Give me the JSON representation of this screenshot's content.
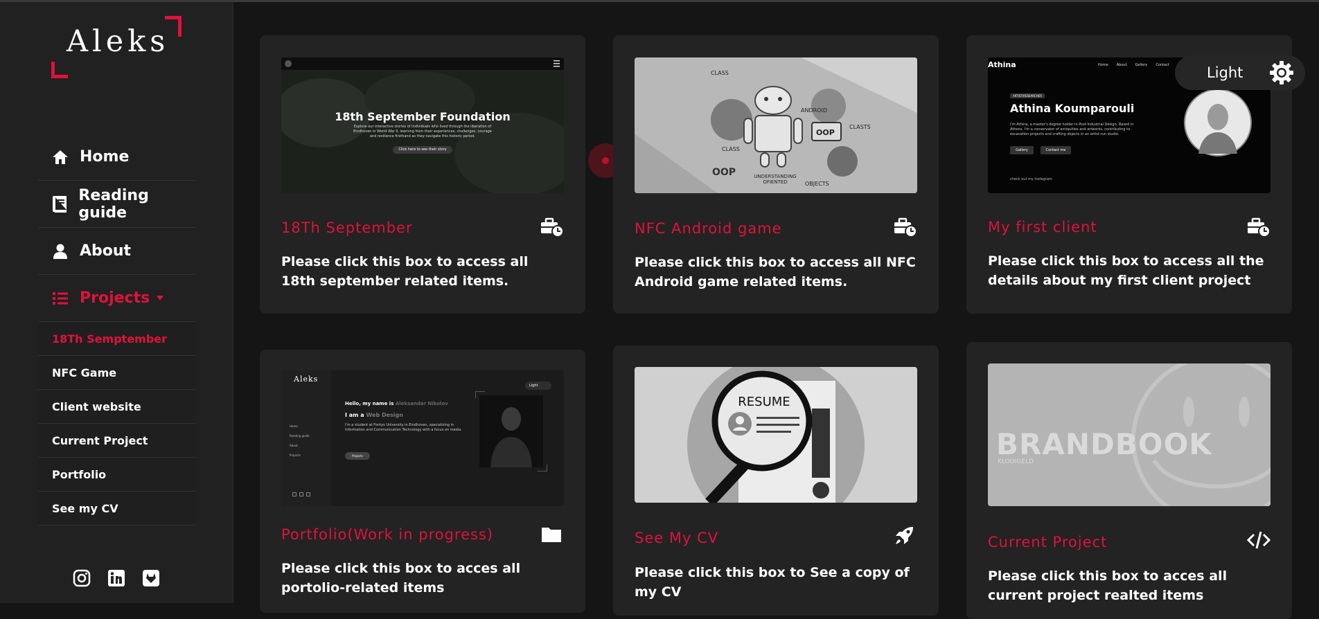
{
  "logo": {
    "text": "Aleks"
  },
  "nav": {
    "items": [
      {
        "label": "Home"
      },
      {
        "label": "Reading guide"
      },
      {
        "label": "About"
      },
      {
        "label": "Projects"
      }
    ],
    "projects_sub": [
      {
        "label": "18Th Semptember"
      },
      {
        "label": "NFC Game"
      },
      {
        "label": "Client website"
      },
      {
        "label": "Current Project"
      },
      {
        "label": "Portfolio"
      },
      {
        "label": "See my CV"
      }
    ]
  },
  "theme_toggle": {
    "label": "Light"
  },
  "cards": [
    {
      "title": "18Th September",
      "desc": "Please click this box to access all 18th september related items.",
      "icon": "briefcase-clock-icon",
      "thumb": {
        "heading": "18th September Foundation",
        "body": "Explore our interactive stories of individuals who lived through the liberation of Eindhoven in World War II, learning from their experiences, challenges, courage and resilience firsthand as they navigate this historic period.",
        "button": "Click here to see their story"
      }
    },
    {
      "title": "NFC Android game",
      "desc": "Please click this box to access all NFC Android game related items.",
      "icon": "briefcase-clock-icon",
      "thumb": {
        "labels": [
          "CLASS",
          "ANDROID",
          "OOP",
          "CLASS",
          "OOP",
          "CLASTS",
          "UNDERSTANDING OFIENTED",
          "OBJECTS"
        ]
      }
    },
    {
      "title": "My first client",
      "desc": "Please click this box to access all the details about my first client project",
      "icon": "briefcase-clock-icon",
      "thumb": {
        "brand": "Athina",
        "nav": [
          "Home",
          "About",
          "Gallery",
          "Contact"
        ],
        "badge": "ARTIST/RESEARCHER",
        "name": "Athina Koumparouli",
        "body": "I'm Athina, a master's degree holder in Post-Industrial Design. Based in Athens, I'm a conservator of antiquities and artworks, contributing to excavation projects and crafting objects in an artist-run studio.",
        "btn1": "Gallery",
        "btn2": "Contact me",
        "footer": "check out my instagram"
      }
    },
    {
      "title": "Portfolio(Work in progress)",
      "desc": "Please click this box to acces all portolio-related items",
      "icon": "folder-icon",
      "thumb": {
        "logo": "Aleks",
        "toggle": "Light",
        "hello": "Hello, my name is",
        "name": "Aleksandar Nikolov",
        "iam": "I am a",
        "role": "Web Design",
        "body": "I'm a student at Fontys University in Eindhoven, specializing in Information and Communication Technology with a focus on media.",
        "btn": "Projects",
        "nav": [
          "Home",
          "Reading guide",
          "About",
          "Projects"
        ]
      }
    },
    {
      "title": "See My CV",
      "desc": "Please click this box to See a copy of my CV",
      "icon": "rocket-icon",
      "thumb": {
        "label": "RESUME"
      }
    },
    {
      "title": "Current Project",
      "desc": "Please click this box to acces all current project realted items",
      "icon": "code-icon",
      "thumb": {
        "heading": "BRANDBOOK",
        "sub": "KLOOIGELD"
      }
    }
  ],
  "colors": {
    "accent": "#e0123c",
    "bg": "#151515",
    "panel": "#212121",
    "card": "#232323"
  }
}
